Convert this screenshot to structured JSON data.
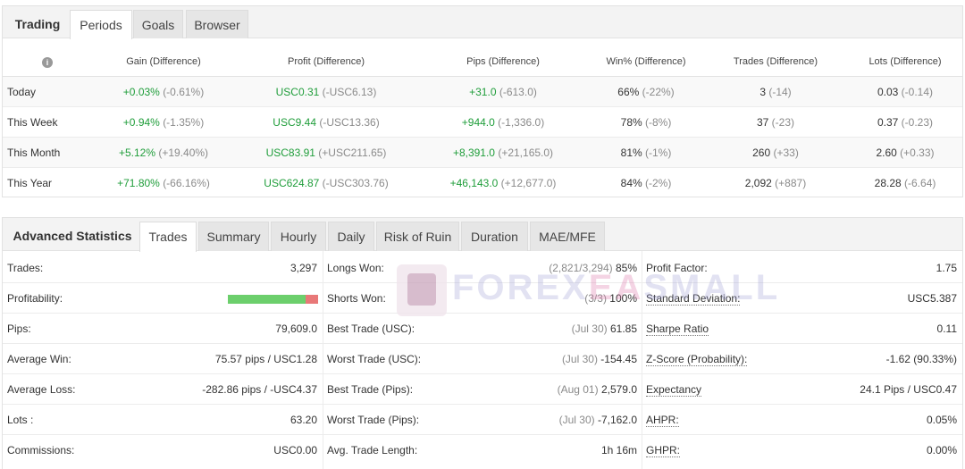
{
  "periods_panel": {
    "tabs": [
      {
        "label": "Trading",
        "kind": "title"
      },
      {
        "label": "Periods",
        "kind": "active"
      },
      {
        "label": "Goals",
        "kind": "tab"
      },
      {
        "label": "Browser",
        "kind": "tab"
      }
    ],
    "headers": [
      "Gain (Difference)",
      "Profit (Difference)",
      "Pips (Difference)",
      "Win% (Difference)",
      "Trades (Difference)",
      "Lots (Difference)"
    ],
    "info_icon": "i",
    "rows": [
      {
        "period": "Today",
        "gain": "+0.03%",
        "gain_diff": "(-0.61%)",
        "profit": "USC0.31",
        "profit_diff": "(-USC6.13)",
        "pips": "+31.0",
        "pips_diff": "(-613.0)",
        "win": "66%",
        "win_diff": "(-22%)",
        "trades": "3",
        "trades_diff": "(-14)",
        "lots": "0.03",
        "lots_diff": "(-0.14)"
      },
      {
        "period": "This Week",
        "gain": "+0.94%",
        "gain_diff": "(-1.35%)",
        "profit": "USC9.44",
        "profit_diff": "(-USC13.36)",
        "pips": "+944.0",
        "pips_diff": "(-1,336.0)",
        "win": "78%",
        "win_diff": "(-8%)",
        "trades": "37",
        "trades_diff": "(-23)",
        "lots": "0.37",
        "lots_diff": "(-0.23)"
      },
      {
        "period": "This Month",
        "gain": "+5.12%",
        "gain_diff": "(+19.40%)",
        "profit": "USC83.91",
        "profit_diff": "(+USC211.65)",
        "pips": "+8,391.0",
        "pips_diff": "(+21,165.0)",
        "win": "81%",
        "win_diff": "(-1%)",
        "trades": "260",
        "trades_diff": "(+33)",
        "lots": "2.60",
        "lots_diff": "(+0.33)"
      },
      {
        "period": "This Year",
        "gain": "+71.80%",
        "gain_diff": "(-66.16%)",
        "profit": "USC624.87",
        "profit_diff": "(-USC303.76)",
        "pips": "+46,143.0",
        "pips_diff": "(+12,677.0)",
        "win": "84%",
        "win_diff": "(-2%)",
        "trades": "2,092",
        "trades_diff": "(+887)",
        "lots": "28.28",
        "lots_diff": "(-6.64)"
      }
    ]
  },
  "advanced_panel": {
    "tabs": [
      {
        "label": "Advanced Statistics",
        "kind": "title"
      },
      {
        "label": "Trades",
        "kind": "active"
      },
      {
        "label": "Summary",
        "kind": "tab"
      },
      {
        "label": "Hourly",
        "kind": "tab"
      },
      {
        "label": "Daily",
        "kind": "tab"
      },
      {
        "label": "Risk of Ruin",
        "kind": "tab"
      },
      {
        "label": "Duration",
        "kind": "tab"
      },
      {
        "label": "MAE/MFE",
        "kind": "tab"
      }
    ],
    "col1": [
      {
        "label": "Trades:",
        "value": "3,297"
      },
      {
        "label": "Profitability:",
        "value": ""
      },
      {
        "label": "Pips:",
        "value": "79,609.0"
      },
      {
        "label": "Average Win:",
        "value": "75.57 pips / USC1.28"
      },
      {
        "label": "Average Loss:",
        "value": "-282.86 pips / -USC4.37"
      },
      {
        "label": "Lots :",
        "value": "63.20"
      },
      {
        "label": "Commissions:",
        "value": "USC0.00"
      }
    ],
    "profitability_win_fraction": 0.86,
    "col2": [
      {
        "label": "Longs Won:",
        "muted": "(2,821/3,294)",
        "value": "85%"
      },
      {
        "label": "Shorts Won:",
        "muted": "(3/3)",
        "value": "100%"
      },
      {
        "label": "Best Trade (USC):",
        "muted": "(Jul 30)",
        "value": "61.85"
      },
      {
        "label": "Worst Trade (USC):",
        "muted": "(Jul 30)",
        "value": "-154.45"
      },
      {
        "label": "Best Trade (Pips):",
        "muted": "(Aug 01)",
        "value": "2,579.0"
      },
      {
        "label": "Worst Trade (Pips):",
        "muted": "(Jul 30)",
        "value": "-7,162.0"
      },
      {
        "label": "Avg. Trade Length:",
        "muted": "",
        "value": "1h 16m"
      }
    ],
    "col3": [
      {
        "label": "Profit Factor:",
        "value": "1.75",
        "underlined": false
      },
      {
        "label": "Standard Deviation:",
        "value": "USC5.387",
        "underlined": true
      },
      {
        "label": "Sharpe Ratio",
        "value": "0.11",
        "underlined": true
      },
      {
        "label": "Z-Score (Probability):",
        "value": "-1.62 (90.33%)",
        "underlined": true
      },
      {
        "label": "Expectancy",
        "value": "24.1 Pips / USC0.47",
        "underlined": true
      },
      {
        "label": "AHPR:",
        "value": "0.05%",
        "underlined": true
      },
      {
        "label": "GHPR:",
        "value": "0.00%",
        "underlined": true
      }
    ]
  },
  "watermark": {
    "part1": "FOREX",
    "part2": "EA",
    "part3": "SMALL",
    "badge_text": "EA"
  },
  "colors": {
    "positive": "#1f9d3a",
    "muted": "#8a8a8a",
    "profit_bar_win": "#6ccf6c",
    "profit_bar_loss": "#e87878"
  }
}
